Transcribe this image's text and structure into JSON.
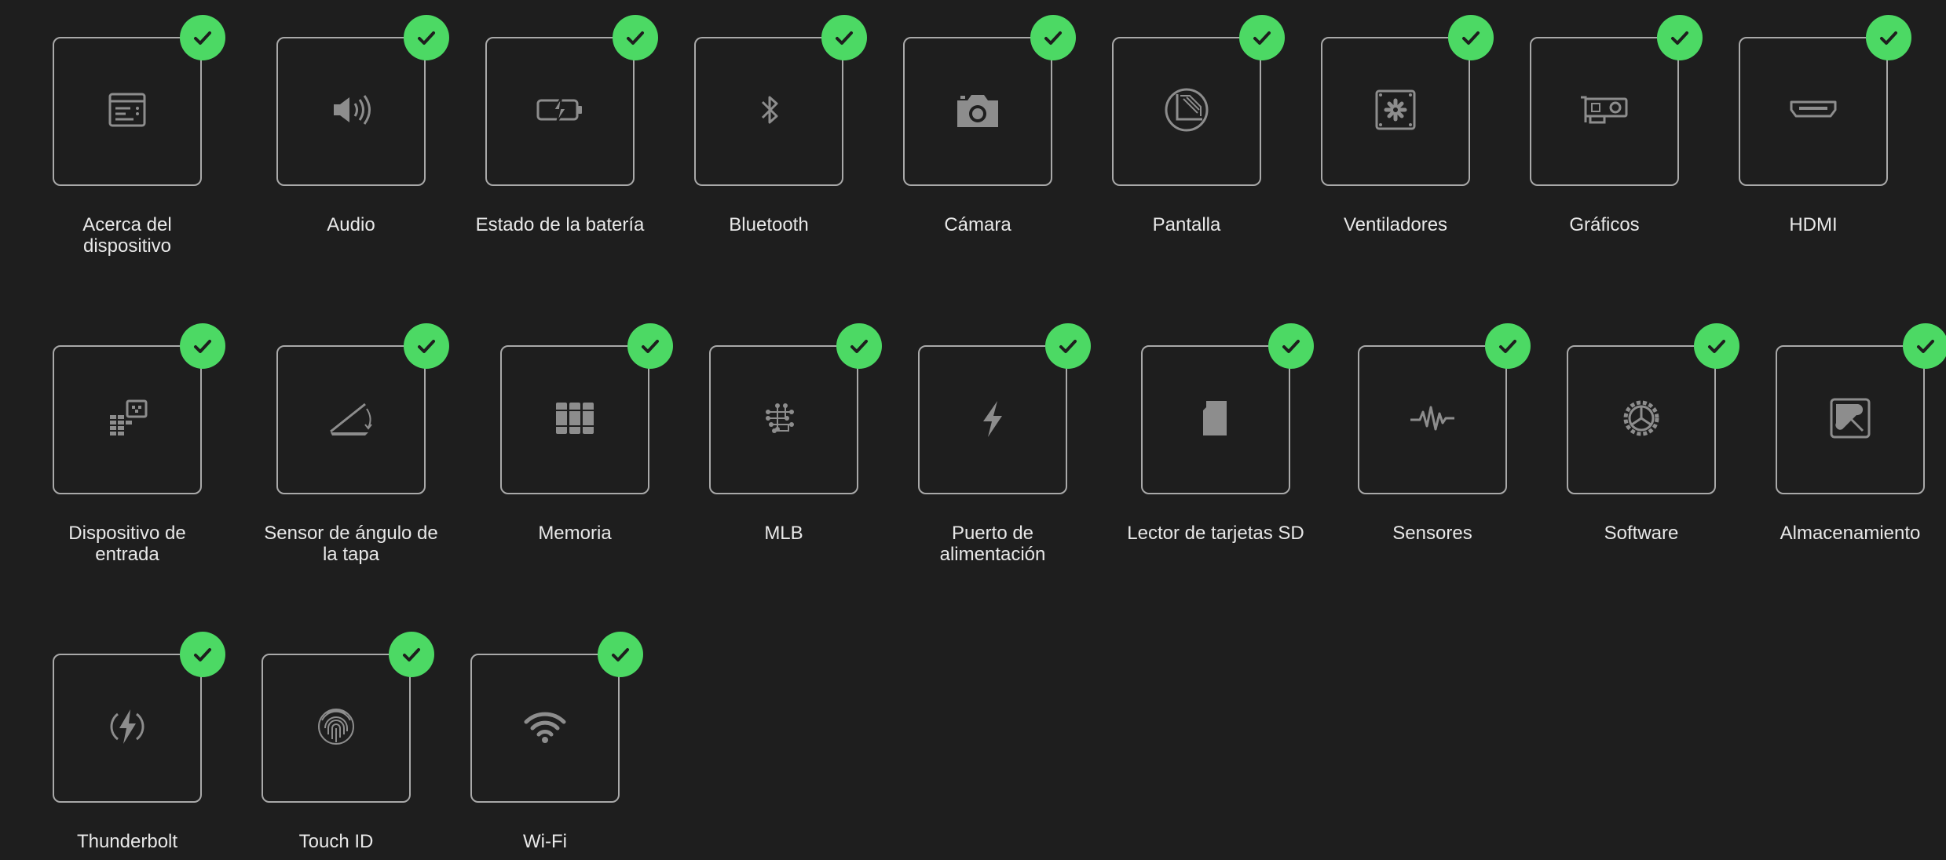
{
  "colors": {
    "background": "#1e1e1e",
    "tile_border": "#a9a9a9",
    "icon": "#8d8d8d",
    "check_badge": "#4cd964",
    "label_text": "#e8e8e8"
  },
  "diagnostics": [
    {
      "id": "about",
      "icon": "about-icon",
      "label_lines": [
        "Acerca del",
        "dispositivo"
      ],
      "status": "passed"
    },
    {
      "id": "audio",
      "icon": "speaker-icon",
      "label_lines": [
        "Audio"
      ],
      "status": "passed"
    },
    {
      "id": "battery",
      "icon": "battery-icon",
      "label_lines": [
        "Estado de la batería"
      ],
      "status": "passed"
    },
    {
      "id": "bluetooth",
      "icon": "bluetooth-icon",
      "label_lines": [
        "Bluetooth"
      ],
      "status": "passed"
    },
    {
      "id": "camera",
      "icon": "camera-icon",
      "label_lines": [
        "Cámara"
      ],
      "status": "passed"
    },
    {
      "id": "display",
      "icon": "display-icon",
      "label_lines": [
        "Pantalla"
      ],
      "status": "passed"
    },
    {
      "id": "fans",
      "icon": "fan-icon",
      "label_lines": [
        "Ventiladores"
      ],
      "status": "passed"
    },
    {
      "id": "graphics",
      "icon": "graphics-card-icon",
      "label_lines": [
        "Gráficos"
      ],
      "status": "passed"
    },
    {
      "id": "hdmi",
      "icon": "hdmi-icon",
      "label_lines": [
        "HDMI"
      ],
      "status": "passed"
    },
    {
      "id": "input",
      "icon": "input-device-icon",
      "label_lines": [
        "Dispositivo de",
        "entrada"
      ],
      "status": "passed"
    },
    {
      "id": "lid",
      "icon": "lid-angle-icon",
      "label_lines": [
        "Sensor de ángulo de",
        "la tapa"
      ],
      "status": "passed"
    },
    {
      "id": "memory",
      "icon": "memory-icon",
      "label_lines": [
        "Memoria"
      ],
      "status": "passed"
    },
    {
      "id": "mlb",
      "icon": "logic-board-icon",
      "label_lines": [
        "MLB"
      ],
      "status": "passed"
    },
    {
      "id": "power",
      "icon": "power-port-icon",
      "label_lines": [
        "Puerto de",
        "alimentación"
      ],
      "status": "passed"
    },
    {
      "id": "sd",
      "icon": "sd-card-icon",
      "label_lines": [
        "Lector de tarjetas SD"
      ],
      "status": "passed"
    },
    {
      "id": "sensors",
      "icon": "sensor-wave-icon",
      "label_lines": [
        "Sensores"
      ],
      "status": "passed"
    },
    {
      "id": "software",
      "icon": "gear-icon",
      "label_lines": [
        "Software"
      ],
      "status": "passed"
    },
    {
      "id": "storage",
      "icon": "storage-icon",
      "label_lines": [
        "Almacenamiento"
      ],
      "status": "passed"
    },
    {
      "id": "thunderbolt",
      "icon": "thunderbolt-icon",
      "label_lines": [
        "Thunderbolt"
      ],
      "status": "passed"
    },
    {
      "id": "touchid",
      "icon": "fingerprint-icon",
      "label_lines": [
        "Touch ID"
      ],
      "status": "passed"
    },
    {
      "id": "wifi",
      "icon": "wifi-icon",
      "label_lines": [
        "Wi-Fi"
      ],
      "status": "passed"
    }
  ]
}
